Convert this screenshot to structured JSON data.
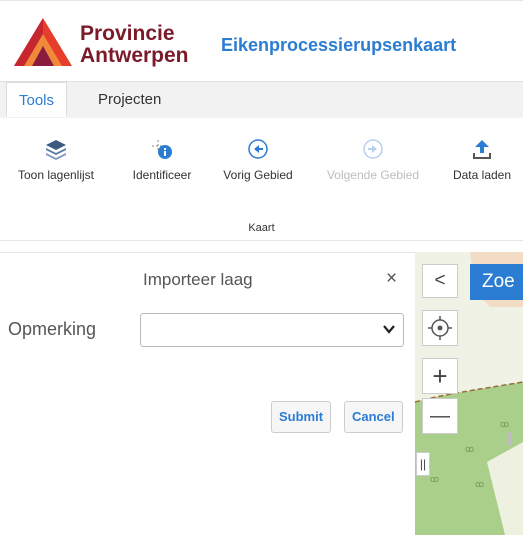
{
  "header": {
    "brand_line1": "Provincie",
    "brand_line2": "Antwerpen",
    "app_title": "Eikenprocessierupsenkaart"
  },
  "tabs": [
    {
      "label": "Tools",
      "active": true
    },
    {
      "label": "Projecten",
      "active": false
    }
  ],
  "ribbon": {
    "buttons": [
      {
        "label": "Toon lagenlijst",
        "icon": "layers-icon",
        "enabled": true
      },
      {
        "label": "Identificeer",
        "icon": "info-crosshair-icon",
        "enabled": true
      },
      {
        "label": "Vorig Gebied",
        "icon": "arrow-left-circle-icon",
        "enabled": true
      },
      {
        "label": "Volgende Gebied",
        "icon": "arrow-right-circle-icon",
        "enabled": false
      },
      {
        "label": "Data laden",
        "icon": "upload-icon",
        "enabled": true
      }
    ],
    "group_label": "Kaart"
  },
  "panel": {
    "title": "Importeer laag",
    "close_glyph": "×",
    "field_label": "Opmerking",
    "select_value": "",
    "submit_label": "Submit",
    "cancel_label": "Cancel"
  },
  "map": {
    "collapse_glyph": "<",
    "search_label": "Zoe",
    "zoom_in_glyph": "+",
    "zoom_out_glyph": "—",
    "handle_glyph": "||"
  },
  "colors": {
    "accent": "#2b7cd3",
    "brand": "#7b1b2a",
    "map_green": "#a9cf8b"
  }
}
